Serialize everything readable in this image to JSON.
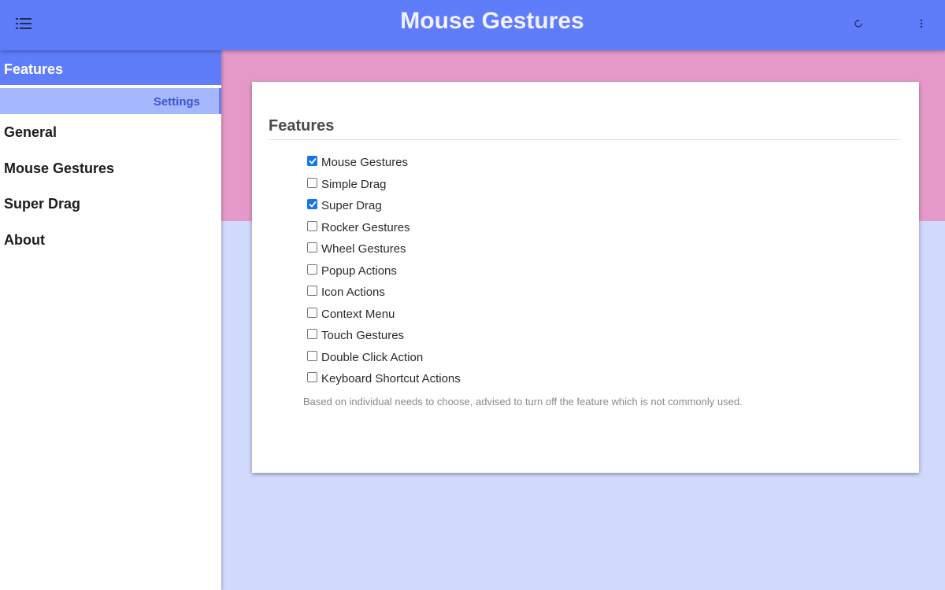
{
  "header": {
    "title": "Mouse Gestures",
    "menu_icon": "list-menu-icon",
    "reset_icon": "reload-icon",
    "more_icon": "vertical-dots-icon",
    "bar_color": "#5f7cfb"
  },
  "sidebar": {
    "section_label": "Features",
    "sub_label": "Settings",
    "items": [
      {
        "label": "General"
      },
      {
        "label": "Mouse Gestures"
      },
      {
        "label": "Super Drag"
      },
      {
        "label": "About"
      }
    ]
  },
  "main": {
    "card_title": "Features",
    "features": [
      {
        "label": "Mouse Gestures",
        "checked": true
      },
      {
        "label": "Simple Drag",
        "checked": false
      },
      {
        "label": "Super Drag",
        "checked": true
      },
      {
        "label": "Rocker Gestures",
        "checked": false
      },
      {
        "label": "Wheel Gestures",
        "checked": false
      },
      {
        "label": "Popup Actions",
        "checked": false
      },
      {
        "label": "Icon Actions",
        "checked": false
      },
      {
        "label": "Context Menu",
        "checked": false
      },
      {
        "label": "Touch Gestures",
        "checked": false
      },
      {
        "label": "Double Click Action",
        "checked": false
      },
      {
        "label": "Keyboard Shortcut Actions",
        "checked": false
      }
    ],
    "hint": "Based on individual needs to choose, advised to turn off the feature which is not commonly used."
  },
  "colors": {
    "accent": "#5f7cfb",
    "pink_band": "#e499c8",
    "background": "#d1d9fd",
    "checkbox_checked": "#1a73e8"
  }
}
